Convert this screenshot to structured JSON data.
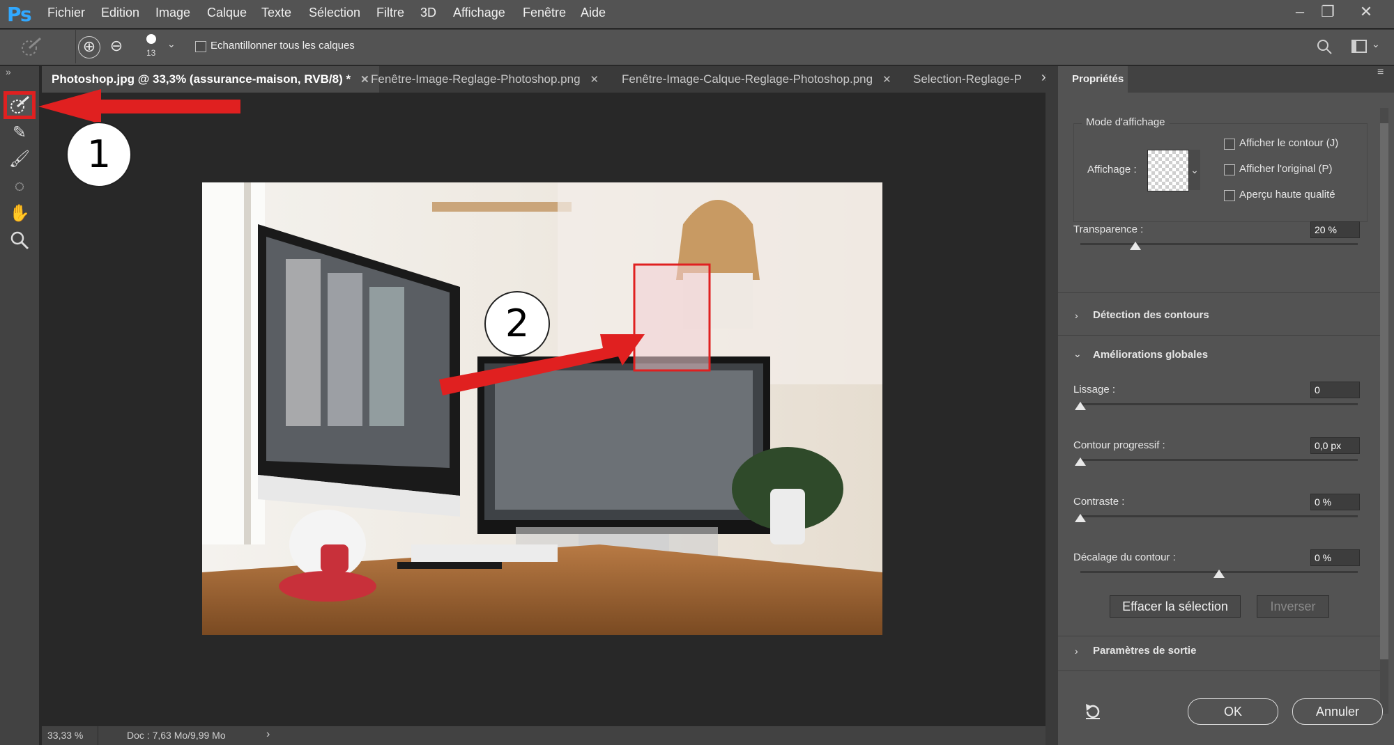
{
  "app": {
    "logo": "Ps"
  },
  "menu": [
    "Fichier",
    "Edition",
    "Image",
    "Calque",
    "Texte",
    "Sélection",
    "Filtre",
    "3D",
    "Affichage",
    "Fenêtre",
    "Aide"
  ],
  "window_controls": {
    "minimize": "–",
    "restore": "❐",
    "close": "✕"
  },
  "options": {
    "brush_size": "13",
    "sample_all_layers_label": "Echantillonner tous les calques"
  },
  "tabs": [
    {
      "label": "Photoshop.jpg @ 33,3% (assurance-maison, RVB/8) *",
      "close": "✕"
    },
    {
      "label": "Fenêtre-Image-Reglage-Photoshop.png",
      "close": "✕"
    },
    {
      "label": "Fenêtre-Image-Calque-Reglage-Photoshop.png",
      "close": "✕"
    },
    {
      "label": "Selection-Reglage-P",
      "close": ""
    }
  ],
  "tab_overflow": "»",
  "status": {
    "zoom": "33,33 %",
    "doc": "Doc : 7,63 Mo/9,99 Mo",
    "arrow": "›"
  },
  "annotations": {
    "one": "1",
    "two": "2",
    "highlight_color": "#e02020"
  },
  "properties": {
    "tab_title": "Propriétés",
    "display_mode": {
      "title": "Mode d'affichage",
      "display_label": "Affichage :",
      "show_edge": "Afficher le contour (J)",
      "show_original": "Afficher l'original (P)",
      "high_quality": "Aperçu haute qualité"
    },
    "transparency": {
      "label": "Transparence :",
      "value": "20 %",
      "level": 0.2
    },
    "edge_detection": "Détection des contours",
    "global_refinements": {
      "title": "Améliorations globales",
      "smooth": {
        "label": "Lissage :",
        "value": "0",
        "level": 0
      },
      "feather": {
        "label": "Contour progressif :",
        "value": "0,0 px",
        "level": 0
      },
      "contrast": {
        "label": "Contraste :",
        "value": "0 %",
        "level": 0
      },
      "shift_edge": {
        "label": "Décalage du contour :",
        "value": "0 %",
        "level": 0.5
      }
    },
    "clear_selection": "Effacer la sélection",
    "invert": "Inverser",
    "output_settings": "Paramètres de sortie",
    "reset_icon": "reset-icon",
    "ok": "OK",
    "cancel": "Annuler"
  }
}
